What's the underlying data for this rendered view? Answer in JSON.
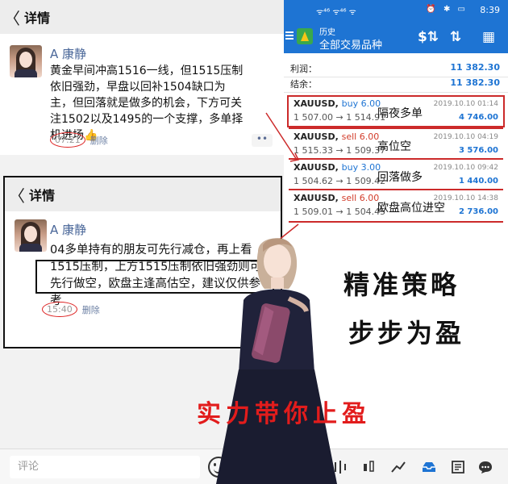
{
  "left": {
    "header1": {
      "back_label": "〈",
      "title": "详情"
    },
    "post1": {
      "author": "A 康静",
      "text": "黄金早间冲高1516一线，但1515压制依旧强劲，早盘以回补1504缺口为主，但回落就是做多的机会，下方可关注1502以及1495的一个支撑，多单择机进场👍",
      "time": "07:21",
      "delete_label": "删除",
      "more_label": "••"
    },
    "header2": {
      "back_label": "〈",
      "title": "详情"
    },
    "post2": {
      "author": "A 康静",
      "text": "04多单持有的朋友可先行减仓，再上看1515压制，上方1515压制依旧强劲则可先行做空，欧盘主逢高估空，建议仅供参考",
      "time": "15:40",
      "delete_label": "删除"
    },
    "bottom": {
      "comment_placeholder": "评论"
    }
  },
  "right": {
    "statusbar": {
      "signal": "ᯤ⁴⁶ ᯤ⁴⁶ ᯤ",
      "icons": "⏰ ✱ ▭",
      "time": "8:39"
    },
    "appbar": {
      "subtitle": "历史",
      "title": "全部交易品种",
      "actions": [
        "$⇅",
        "⇅",
        "▦"
      ]
    },
    "summary": [
      {
        "label": "利润：",
        "value": "11 382.30"
      },
      {
        "label": "结余：",
        "value": "11 382.30"
      }
    ],
    "trades": [
      {
        "symbol": "XAUUSD,",
        "side": "buy 6.00",
        "kind": "buy",
        "prices": "1 507.00 → 1 514.91",
        "date": "2019.10.10 01:14",
        "pnl": "4 746.00",
        "note": "隔夜多单"
      },
      {
        "symbol": "XAUUSD,",
        "side": "sell 6.00",
        "kind": "sell",
        "prices": "1 515.33 → 1 509.37",
        "date": "2019.10.10 04:19",
        "pnl": "3 576.00",
        "note": "高位空"
      },
      {
        "symbol": "XAUUSD,",
        "side": "buy 3.00",
        "kind": "buy",
        "prices": "1 504.62 → 1 509.42",
        "date": "2019.10.10 09:42",
        "pnl": "1 440.00",
        "note": "回落做多"
      },
      {
        "symbol": "XAUUSD,",
        "side": "sell 6.00",
        "kind": "sell",
        "prices": "1 509.01 → 1 504.45",
        "date": "2019.10.10 14:38",
        "pnl": "2 736.00",
        "note": "欧盘高位进空"
      }
    ],
    "bottom_nav": [
      "quotes-icon",
      "chart-icon",
      "trend-icon",
      "history-icon",
      "news-icon",
      "chat-icon"
    ]
  },
  "overlay": {
    "slogan1": "精准策略",
    "slogan2": "步步为盈",
    "slogan3": "实力带你止盈"
  },
  "colors": {
    "accent": "#1e74d3",
    "sell": "#d23c2a",
    "highlight": "#cc2a2a"
  }
}
